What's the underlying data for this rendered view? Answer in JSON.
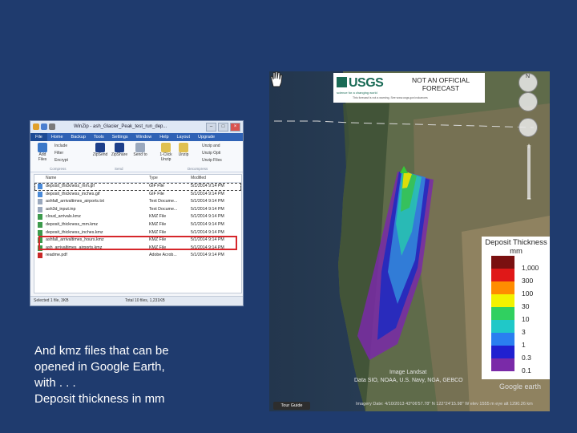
{
  "winzip": {
    "title": "WinZip - ash_Glacier_Peak_test_run_dep...",
    "menu": [
      "File",
      "Home",
      "Backup",
      "Tools",
      "Settings",
      "Window",
      "Help",
      "Layout",
      "Upgrade"
    ],
    "ribbon": {
      "add_label": "Add Files",
      "include_label": "Include",
      "filter_label": "Filter",
      "encrypt_label": "Encrypt",
      "zipsend_label": "ZipSend",
      "zipshare_label": "ZipShare",
      "send_label": "Send to",
      "unzip_label": "1-Click Unzip",
      "unzip2_label": "Unzip",
      "unzipand_label": "Unzip and",
      "unzipopt_label": "Unzip Opti",
      "unzipfiles_label": "Unzip Files",
      "group_compress": "Compress",
      "group_send": "Send",
      "group_decompress": "Decompress"
    },
    "columns": [
      "Name",
      "Type",
      "Modified"
    ],
    "files": [
      {
        "name": "deposit_thickness_mm.gif",
        "type": "GIF File",
        "modified": "5/1/2014 9:14 PM"
      },
      {
        "name": "deposit_thickness_inches.gif",
        "type": "GIF File",
        "modified": "5/1/2014 9:14 PM"
      },
      {
        "name": "ashfall_arrivaltimes_airports.txt",
        "type": "Text Docume...",
        "modified": "5/1/2014 9:14 PM"
      },
      {
        "name": "ash3d_input.inp",
        "type": "Text Docume...",
        "modified": "5/1/2014 9:14 PM"
      },
      {
        "name": "cloud_arrivals.kmz",
        "type": "KMZ File",
        "modified": "5/1/2014 9:14 PM"
      },
      {
        "name": "deposit_thickness_mm.kmz",
        "type": "KMZ File",
        "modified": "5/1/2014 9:14 PM"
      },
      {
        "name": "deposit_thickness_inches.kmz",
        "type": "KMZ File",
        "modified": "5/1/2014 9:14 PM"
      },
      {
        "name": "ashfall_arrivaltimes_hours.kmz",
        "type": "KMZ File",
        "modified": "5/1/2014 9:14 PM"
      },
      {
        "name": "ash_arrivaltimes_airports.kmz",
        "type": "KMZ File",
        "modified": "5/1/2014 9:14 PM"
      },
      {
        "name": "readme.pdf",
        "type": "Adobe Acrob...",
        "modified": "5/1/2014 9:14 PM"
      }
    ],
    "status_left": "Selected 1 file, 3KB",
    "status_right": "Total 10 files, 1,231KB"
  },
  "caption": {
    "line1": "And kmz files that can be",
    "line2": "opened in Google Earth,",
    "line3": "with . . .",
    "line4": "Deposit thickness in mm"
  },
  "map": {
    "usgs_logo": "USGS",
    "usgs_tagline": "science for a changing world",
    "usgs_fine": "This forecast is not a warning. See www.usgs.gov/volcanoes",
    "forecast_line1": "NOT AN OFFICIAL",
    "forecast_line2": "FORECAST",
    "legend_title1": "Deposit Thickness",
    "legend_title2": "mm",
    "legend": [
      {
        "label": "1,000",
        "color": "#7a1010"
      },
      {
        "label": "300",
        "color": "#e01818"
      },
      {
        "label": "100",
        "color": "#ff8c00"
      },
      {
        "label": "30",
        "color": "#f2f200"
      },
      {
        "label": "10",
        "color": "#30d060"
      },
      {
        "label": "3",
        "color": "#20c8c8"
      },
      {
        "label": "1",
        "color": "#2a7ff0"
      },
      {
        "label": "0.3",
        "color": "#2020d0"
      },
      {
        "label": "0.1",
        "color": "#7a2aa8"
      }
    ],
    "attribution1": "Image Landsat",
    "attribution2": "Data SIO, NOAA, U.S. Navy, NGA, GEBCO",
    "google_earth": "Google earth",
    "tour_guide": "Tour Guide",
    "statusline": "Imagery Date: 4/10/2013   43°06'57.78\" N  122°24'15.98\" W  elev 1555 m   eye alt 1290.26 km"
  }
}
